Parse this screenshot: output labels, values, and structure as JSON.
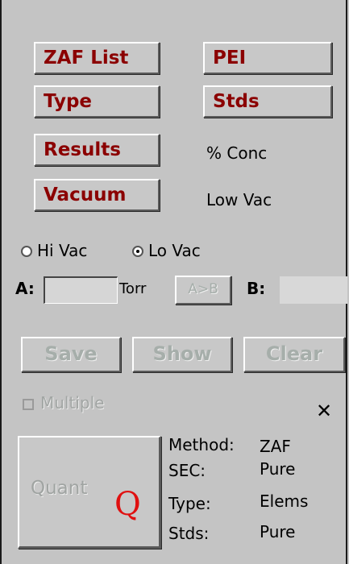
{
  "buttons": {
    "zaf_list": "ZAF List",
    "pei": "PEI",
    "type": "Type",
    "stds": "Stds",
    "results": "Results",
    "vacuum": "Vacuum"
  },
  "results_value": "% Conc",
  "vacuum_value": "Low Vac",
  "vac_mode": {
    "hi_label": "Hi Vac",
    "lo_label": "Lo Vac",
    "selected": "Lo Vac"
  },
  "pressure": {
    "a_label": "A:",
    "a_value": "",
    "unit": "Torr",
    "copy_label": "A>B",
    "b_label": "B:",
    "b_value": ""
  },
  "actions": {
    "save": "Save",
    "show": "Show",
    "clear": "Clear"
  },
  "multiple": {
    "label": "Multiple",
    "checked": false
  },
  "close_glyph": "✕",
  "quant": {
    "label": "Quant",
    "glyph": "Q"
  },
  "info": {
    "method_label": "Method:",
    "method_value": "ZAF",
    "sec_label": "SEC:",
    "sec_value": "Pure",
    "type_label": "Type:",
    "type_value": "Elems",
    "stds_label": "Stds:",
    "stds_value": "Pure"
  },
  "colors": {
    "background": "#c4c4c4",
    "button_text": "#8b0000",
    "disabled_text": "#a6aeaa",
    "quant_q": "#e01010"
  }
}
